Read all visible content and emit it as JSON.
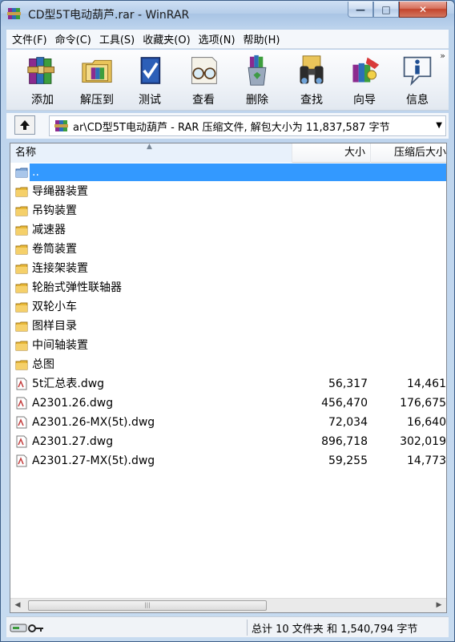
{
  "window": {
    "title": "CD型5T电动葫芦.rar - WinRAR",
    "minimize": "—",
    "maximize": "□",
    "close": "✕"
  },
  "menu": [
    "文件(F)",
    "命令(C)",
    "工具(S)",
    "收藏夹(O)",
    "选项(N)",
    "帮助(H)"
  ],
  "toolbar": {
    "buttons": [
      {
        "label": "添加",
        "icon": "add-books-icon"
      },
      {
        "label": "解压到",
        "icon": "extract-folder-icon"
      },
      {
        "label": "测试",
        "icon": "test-book-icon"
      },
      {
        "label": "查看",
        "icon": "view-glasses-icon"
      },
      {
        "label": "删除",
        "icon": "delete-recycle-icon"
      },
      {
        "label": "查找",
        "icon": "find-binoculars-icon"
      },
      {
        "label": "向导",
        "icon": "wizard-icon"
      },
      {
        "label": "信息",
        "icon": "info-icon"
      }
    ],
    "more": "»"
  },
  "path": {
    "text": "ar\\CD型5T电动葫芦 - RAR 压缩文件, 解包大小为 11,837,587 字节",
    "dropdown": "▼"
  },
  "columns": {
    "name": "名称",
    "size": "大小",
    "packed": "压缩后大小"
  },
  "files": [
    {
      "name": "..",
      "size": "",
      "packed": "",
      "type": "parent",
      "selected": true
    },
    {
      "name": "导绳器装置",
      "size": "",
      "packed": "",
      "type": "folder"
    },
    {
      "name": "吊钩装置",
      "size": "",
      "packed": "",
      "type": "folder"
    },
    {
      "name": "减速器",
      "size": "",
      "packed": "",
      "type": "folder"
    },
    {
      "name": "卷筒装置",
      "size": "",
      "packed": "",
      "type": "folder"
    },
    {
      "name": "连接架装置",
      "size": "",
      "packed": "",
      "type": "folder"
    },
    {
      "name": "轮胎式弹性联轴器",
      "size": "",
      "packed": "",
      "type": "folder"
    },
    {
      "name": "双轮小车",
      "size": "",
      "packed": "",
      "type": "folder"
    },
    {
      "name": "图样目录",
      "size": "",
      "packed": "",
      "type": "folder"
    },
    {
      "name": "中间轴装置",
      "size": "",
      "packed": "",
      "type": "folder"
    },
    {
      "name": "总图",
      "size": "",
      "packed": "",
      "type": "folder"
    },
    {
      "name": "5t汇总表.dwg",
      "size": "56,317",
      "packed": "14,461",
      "type": "dwg"
    },
    {
      "name": "A2301.26.dwg",
      "size": "456,470",
      "packed": "176,675",
      "type": "dwg"
    },
    {
      "name": "A2301.26-MX(5t).dwg",
      "size": "72,034",
      "packed": "16,640",
      "type": "dwg"
    },
    {
      "name": "A2301.27.dwg",
      "size": "896,718",
      "packed": "302,019",
      "type": "dwg"
    },
    {
      "name": "A2301.27-MX(5t).dwg",
      "size": "59,255",
      "packed": "14,773",
      "type": "dwg"
    }
  ],
  "status": {
    "text": "总计 10 文件夹 和 1,540,794 字节"
  },
  "colors": {
    "selection": "#3399ff",
    "folder": "#e8b838",
    "titlebar": "#b5cde9"
  }
}
